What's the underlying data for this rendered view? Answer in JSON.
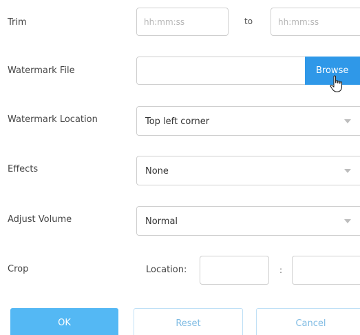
{
  "trim": {
    "label": "Trim",
    "start_placeholder": "hh:mm:ss",
    "to_label": "to",
    "end_placeholder": "hh:mm:ss"
  },
  "watermark_file": {
    "label": "Watermark File",
    "value": "",
    "browse_label": "Browse"
  },
  "watermark_location": {
    "label": "Watermark Location",
    "selected": "Top left corner"
  },
  "effects": {
    "label": "Effects",
    "selected": "None"
  },
  "adjust_volume": {
    "label": "Adjust Volume",
    "selected": "Normal"
  },
  "crop": {
    "label": "Crop",
    "location_label": "Location:",
    "separator": ":",
    "x_value": "",
    "y_value": ""
  },
  "actions": {
    "ok_label": "OK",
    "reset_label": "Reset",
    "cancel_label": "Cancel"
  },
  "colors": {
    "primary": "#2f98e8",
    "primary_light": "#54b8f4",
    "secondary_border": "#bfe0f6",
    "secondary_text": "#7fbbe3"
  },
  "icons": {
    "cursor": "hand-pointer-icon",
    "dropdown": "chevron-down-icon"
  }
}
